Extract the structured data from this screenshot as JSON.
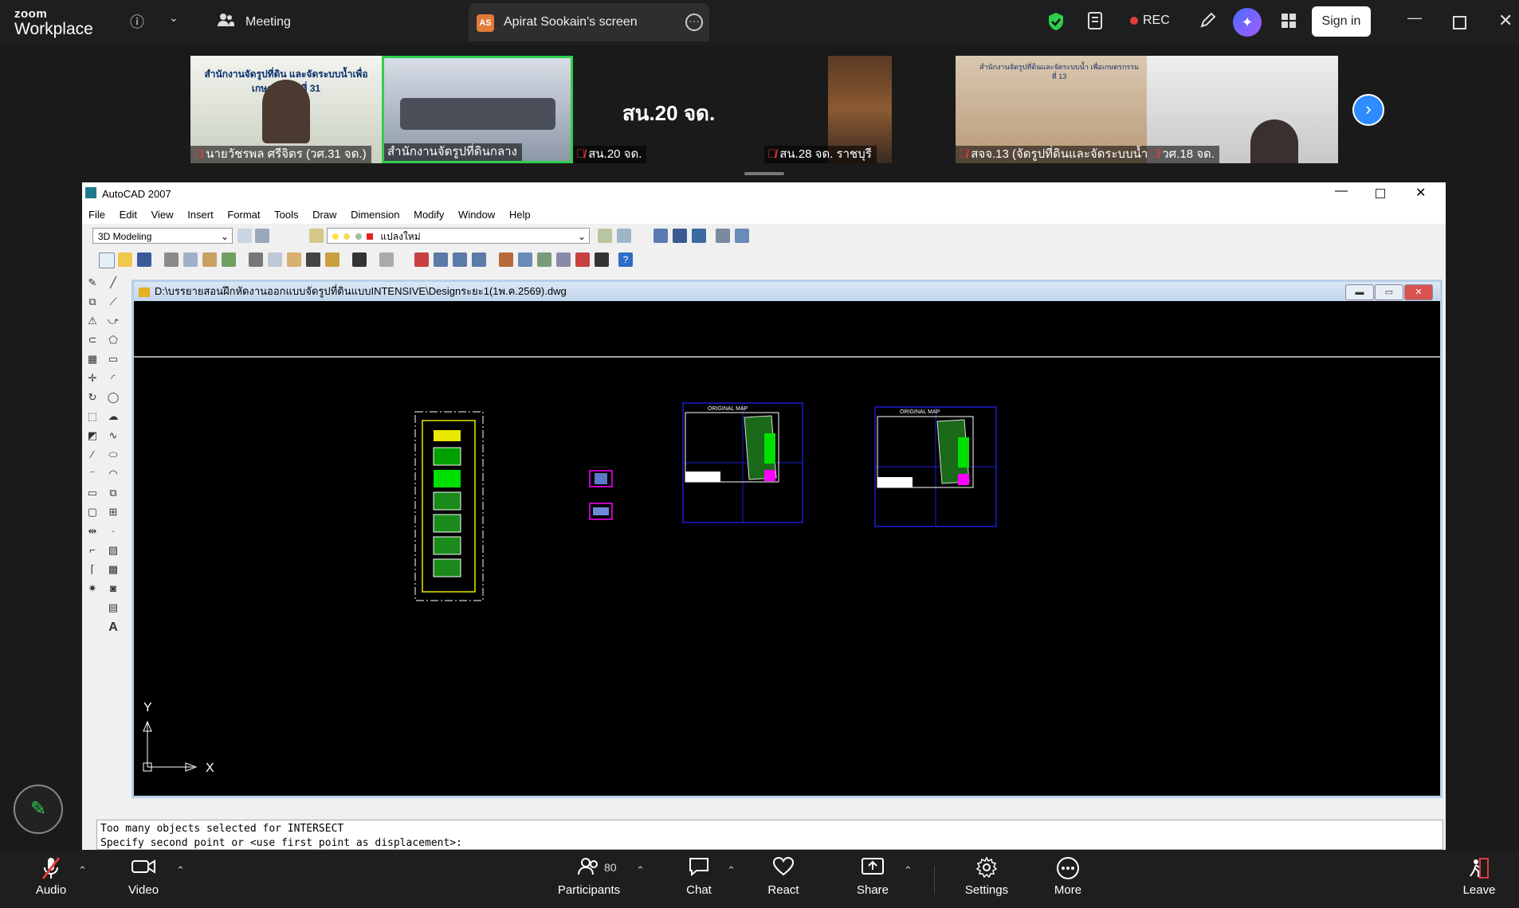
{
  "zoom": {
    "logo_top": "zoom",
    "logo_bottom": "Workplace",
    "meeting_label": "Meeting",
    "share_initials": "AS",
    "share_title": "Apirat Sookain's screen",
    "rec_label": "REC",
    "signin_label": "Sign in",
    "icons": [
      "info-icon",
      "chevron-down-icon",
      "people-icon",
      "more-icon",
      "shield-icon",
      "notes-icon",
      "record-icon",
      "pen-icon",
      "ai-companion-icon",
      "apps-icon",
      "minimize-icon",
      "restore-icon",
      "close-icon"
    ]
  },
  "gallery": {
    "tiles": [
      {
        "name": "นายวัชรพล ศรีจิตร (วศ.31 จด.)",
        "banner": "สำนักงานจัดรูปที่ดิน และจัดระบบน้ำเพื่อเกษตรกรรมที่ 31"
      },
      {
        "name": "สำนักงานจัดรูปที่ดินกลาง",
        "banner": ""
      },
      {
        "name": "สน.20 จด.",
        "banner": "สน.20 จด."
      },
      {
        "name": "สน.28 จด. ราชบุรี",
        "banner": ""
      },
      {
        "name": "สจจ.13 (จัดรูปที่ดินและจัดระบบน้ำ...",
        "banner": "สำนักงานจัดรูปที่ดินและจัดระบบน้ำ เพื่อเกษตรกรรมที่ 13"
      },
      {
        "name": "วศ.18 จด.",
        "banner": ""
      }
    ]
  },
  "acad": {
    "title": "AutoCAD 2007",
    "menu": [
      "File",
      "Edit",
      "View",
      "Insert",
      "Format",
      "Tools",
      "Draw",
      "Dimension",
      "Modify",
      "Window",
      "Help"
    ],
    "workspace": "3D Modeling",
    "layer": "แปลงใหม่",
    "drawing_path": "D:\\บรรยายสอนฝึกหัดงานออกแบบจัดรูปที่ดินแบบINTENSIVE\\Designระยะ1(1พ.ค.2569).dwg",
    "map_label_1": "ORIGINAL MAP",
    "map_label_2": "ORIGINAL MAP",
    "ucs_y": "Y",
    "ucs_x": "X",
    "command_line_1": "Too many objects selected for INTERSECT",
    "command_line_2": "Specify second point or <use first point as displacement>:"
  },
  "bottombar": {
    "audio": "Audio",
    "video": "Video",
    "participants": "Participants",
    "participants_count": "80",
    "chat": "Chat",
    "react": "React",
    "share": "Share",
    "settings": "Settings",
    "more": "More",
    "leave": "Leave"
  },
  "colors": {
    "zoom_bg": "#1e1e1e",
    "speaker_border": "#2fce4e",
    "rec_red": "#e03c3c",
    "accent_blue": "#2d8cff",
    "cad_blue": "#1c1ccf",
    "cad_green": "#00e000",
    "cad_magenta": "#ff00ff",
    "cad_yellow": "#e8e800"
  }
}
